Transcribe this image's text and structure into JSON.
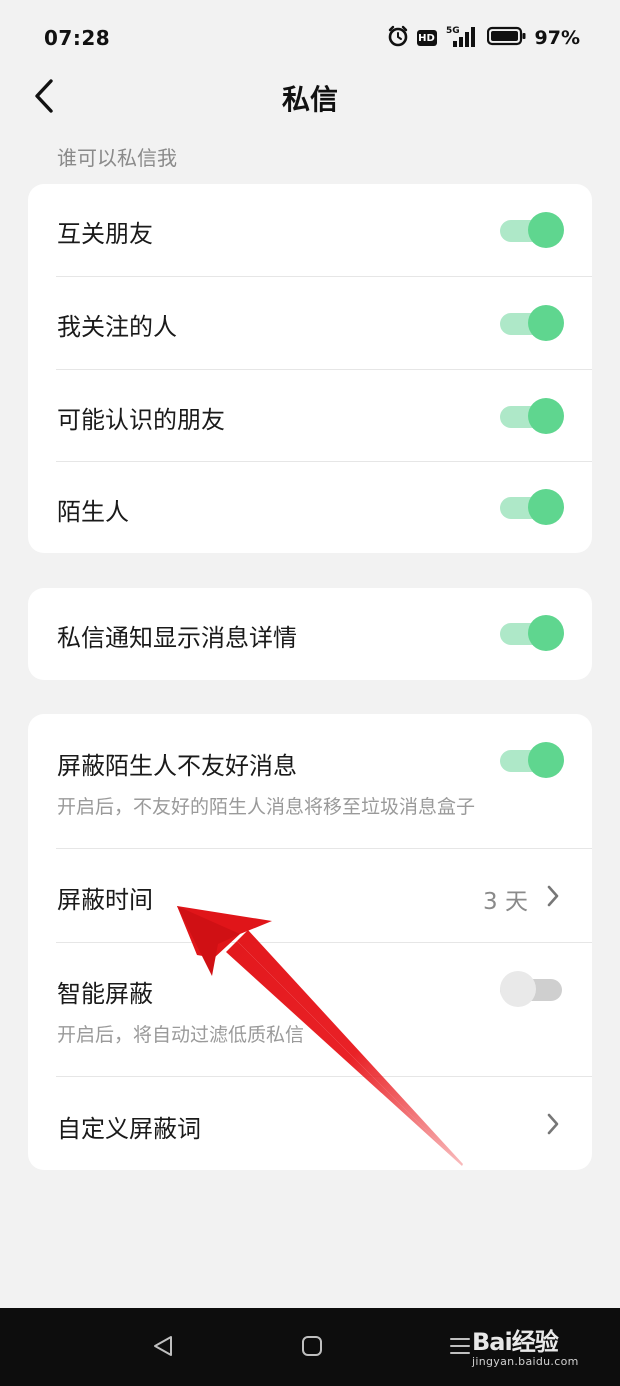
{
  "status_bar": {
    "time": "07:28",
    "hd": "HD",
    "network": "5G",
    "battery": "97%"
  },
  "header": {
    "title": "私信"
  },
  "section": {
    "who_can_message": "谁可以私信我"
  },
  "who_can_message": {
    "items": [
      {
        "label": "互关朋友",
        "toggle": true
      },
      {
        "label": "我关注的人",
        "toggle": true
      },
      {
        "label": "可能认识的朋友",
        "toggle": true
      },
      {
        "label": "陌生人",
        "toggle": true
      }
    ]
  },
  "notification": {
    "label": "私信通知显示消息详情",
    "toggle": true
  },
  "blocking": {
    "block_unfriendly": {
      "label": "屏蔽陌生人不友好消息",
      "sub": "开启后，不友好的陌生人消息将移至垃圾消息盒子",
      "toggle": true
    },
    "block_time": {
      "label": "屏蔽时间",
      "value": "3 天"
    },
    "smart_block": {
      "label": "智能屏蔽",
      "sub": "开启后，将自动过滤低质私信",
      "toggle": false
    },
    "custom_words": {
      "label": "自定义屏蔽词"
    }
  },
  "watermark": {
    "logo": "Bai经验",
    "sub": "jingyan.baidu.com"
  },
  "colors": {
    "toggle_on_knob": "#5fd68f",
    "toggle_on_track": "#aee8c8",
    "toggle_off_knob": "#e9e9e9",
    "toggle_off_track": "#cfcfcf",
    "arrow": "#e8161b"
  }
}
